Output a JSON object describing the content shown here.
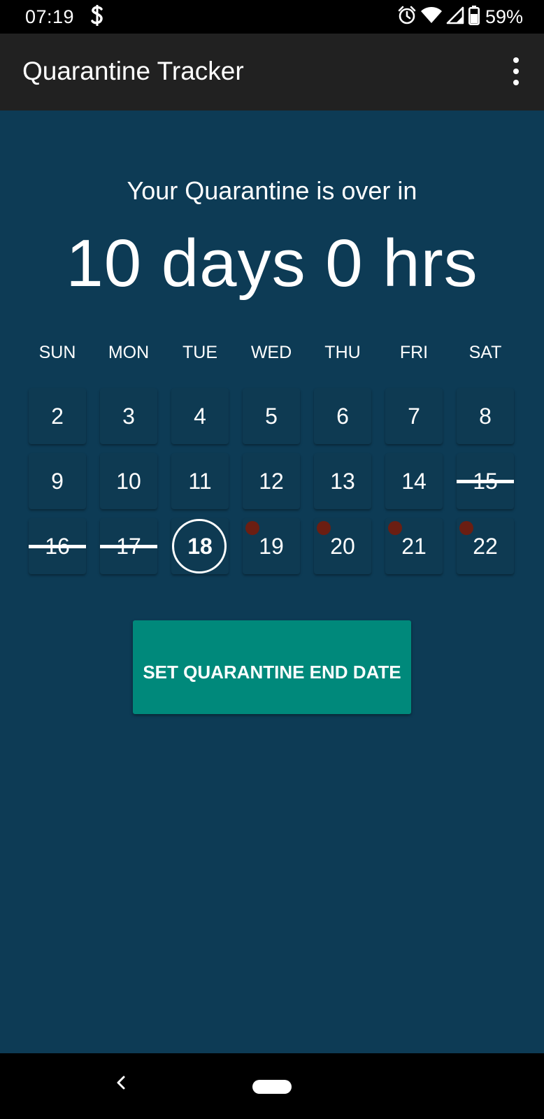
{
  "status_bar": {
    "time": "07:19",
    "notification_icon": "s-icon",
    "battery_percent": "59%",
    "icons": [
      "alarm-icon",
      "wifi-icon",
      "signal-icon",
      "battery-icon"
    ]
  },
  "app_bar": {
    "title": "Quarantine Tracker",
    "menu_icon": "overflow-menu-icon"
  },
  "main": {
    "subtitle": "Your Quarantine is over in",
    "countdown": "10 days 0 hrs",
    "weekdays": [
      "SUN",
      "MON",
      "TUE",
      "WED",
      "THU",
      "FRI",
      "SAT"
    ],
    "weeks": [
      [
        {
          "day": "2",
          "state": "normal"
        },
        {
          "day": "3",
          "state": "normal"
        },
        {
          "day": "4",
          "state": "normal"
        },
        {
          "day": "5",
          "state": "normal"
        },
        {
          "day": "6",
          "state": "normal"
        },
        {
          "day": "7",
          "state": "normal"
        },
        {
          "day": "8",
          "state": "normal"
        }
      ],
      [
        {
          "day": "9",
          "state": "normal"
        },
        {
          "day": "10",
          "state": "normal"
        },
        {
          "day": "11",
          "state": "normal"
        },
        {
          "day": "12",
          "state": "normal"
        },
        {
          "day": "13",
          "state": "normal"
        },
        {
          "day": "14",
          "state": "normal"
        },
        {
          "day": "15",
          "state": "struck"
        }
      ],
      [
        {
          "day": "16",
          "state": "struck"
        },
        {
          "day": "17",
          "state": "struck"
        },
        {
          "day": "18",
          "state": "today"
        },
        {
          "day": "19",
          "state": "marked"
        },
        {
          "day": "20",
          "state": "marked"
        },
        {
          "day": "21",
          "state": "marked"
        },
        {
          "day": "22",
          "state": "marked"
        }
      ]
    ],
    "button_label": "SET QUARANTINE END DATE"
  },
  "colors": {
    "background": "#0d3b55",
    "app_bar": "#212121",
    "button": "#00897b",
    "marker_dot": "#6b1e12"
  },
  "nav_bar": {
    "back_icon": "back-chevron-icon",
    "home_icon": "home-pill-icon"
  }
}
